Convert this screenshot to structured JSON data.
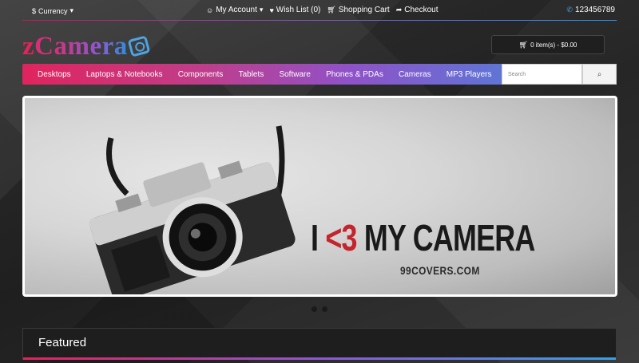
{
  "topbar": {
    "currency_label": "Currency",
    "links": [
      {
        "icon": "user-icon",
        "glyph": "☺",
        "label": "My Account",
        "caret": "▾"
      },
      {
        "icon": "heart-icon",
        "glyph": "♥",
        "label": "Wish List (0)"
      },
      {
        "icon": "cart-icon",
        "glyph": "☆",
        "label": "Shopping Cart"
      },
      {
        "icon": "share-icon",
        "glyph": "➦",
        "label": "Checkout"
      }
    ],
    "phone": "123456789"
  },
  "logo": {
    "z": "z",
    "c": "C",
    "rest": "amera"
  },
  "cart": {
    "label": "0 item(s) - $0.00"
  },
  "nav": {
    "items": [
      "Desktops",
      "Laptops & Notebooks",
      "Components",
      "Tablets",
      "Software",
      "Phones & PDAs",
      "Cameras",
      "MP3 Players"
    ]
  },
  "search": {
    "placeholder": "Search"
  },
  "slider": {
    "text_pre": "I ",
    "text_heart": "<3",
    "text_post": " MY CAMERA",
    "subtext": "99COVERS.COM",
    "slides": 2
  },
  "featured": {
    "title": "Featured"
  },
  "colors": {
    "pink": "#e0245e",
    "purple": "#8e58d0",
    "blue": "#3b8fe0",
    "background": "#2f2f2f"
  }
}
